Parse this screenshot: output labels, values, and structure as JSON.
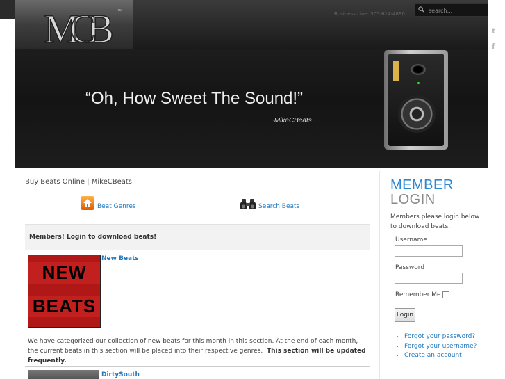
{
  "header": {
    "logo_text": "MCB",
    "business_line": "Business Line: 305-614-4890",
    "search_placeholder": "search...",
    "slogan": "“Oh, How Sweet The Sound!”",
    "signature": "~MikeCBeats~"
  },
  "social": {
    "twitter": "t",
    "facebook": "f"
  },
  "main": {
    "breadcrumb": "Buy Beats Online | MikeCBeats",
    "nav": [
      {
        "label": "Beat Genres",
        "icon": "home-icon"
      },
      {
        "label": "Search Beats",
        "icon": "binoculars-icon"
      }
    ],
    "notice": "Members! Login to download beats!",
    "entries": [
      {
        "title": "New Beats",
        "thumb_text_1": "NEW",
        "thumb_text_2": "BEATS"
      },
      {
        "title": "DirtySouth"
      }
    ],
    "description": "We have categorized our collection of new beats for this month in this section. At the end of each month, the current beats in this section will be placed into their respective genres.",
    "description_bold": "This section will be updated frequently."
  },
  "sidebar": {
    "title_1": "MEMBER",
    "title_2": "LOGIN",
    "intro": "Members please login below to download beats.",
    "username_label": "Username",
    "password_label": "Password",
    "remember_label": "Remember Me",
    "login_button": "Login",
    "links": [
      "Forgot your password?",
      "Forgot your username?",
      "Create an account"
    ]
  },
  "colors": {
    "accent": "#1f79c0",
    "member_blue": "#2a87d0",
    "header_dark": "#1a1a1a"
  }
}
